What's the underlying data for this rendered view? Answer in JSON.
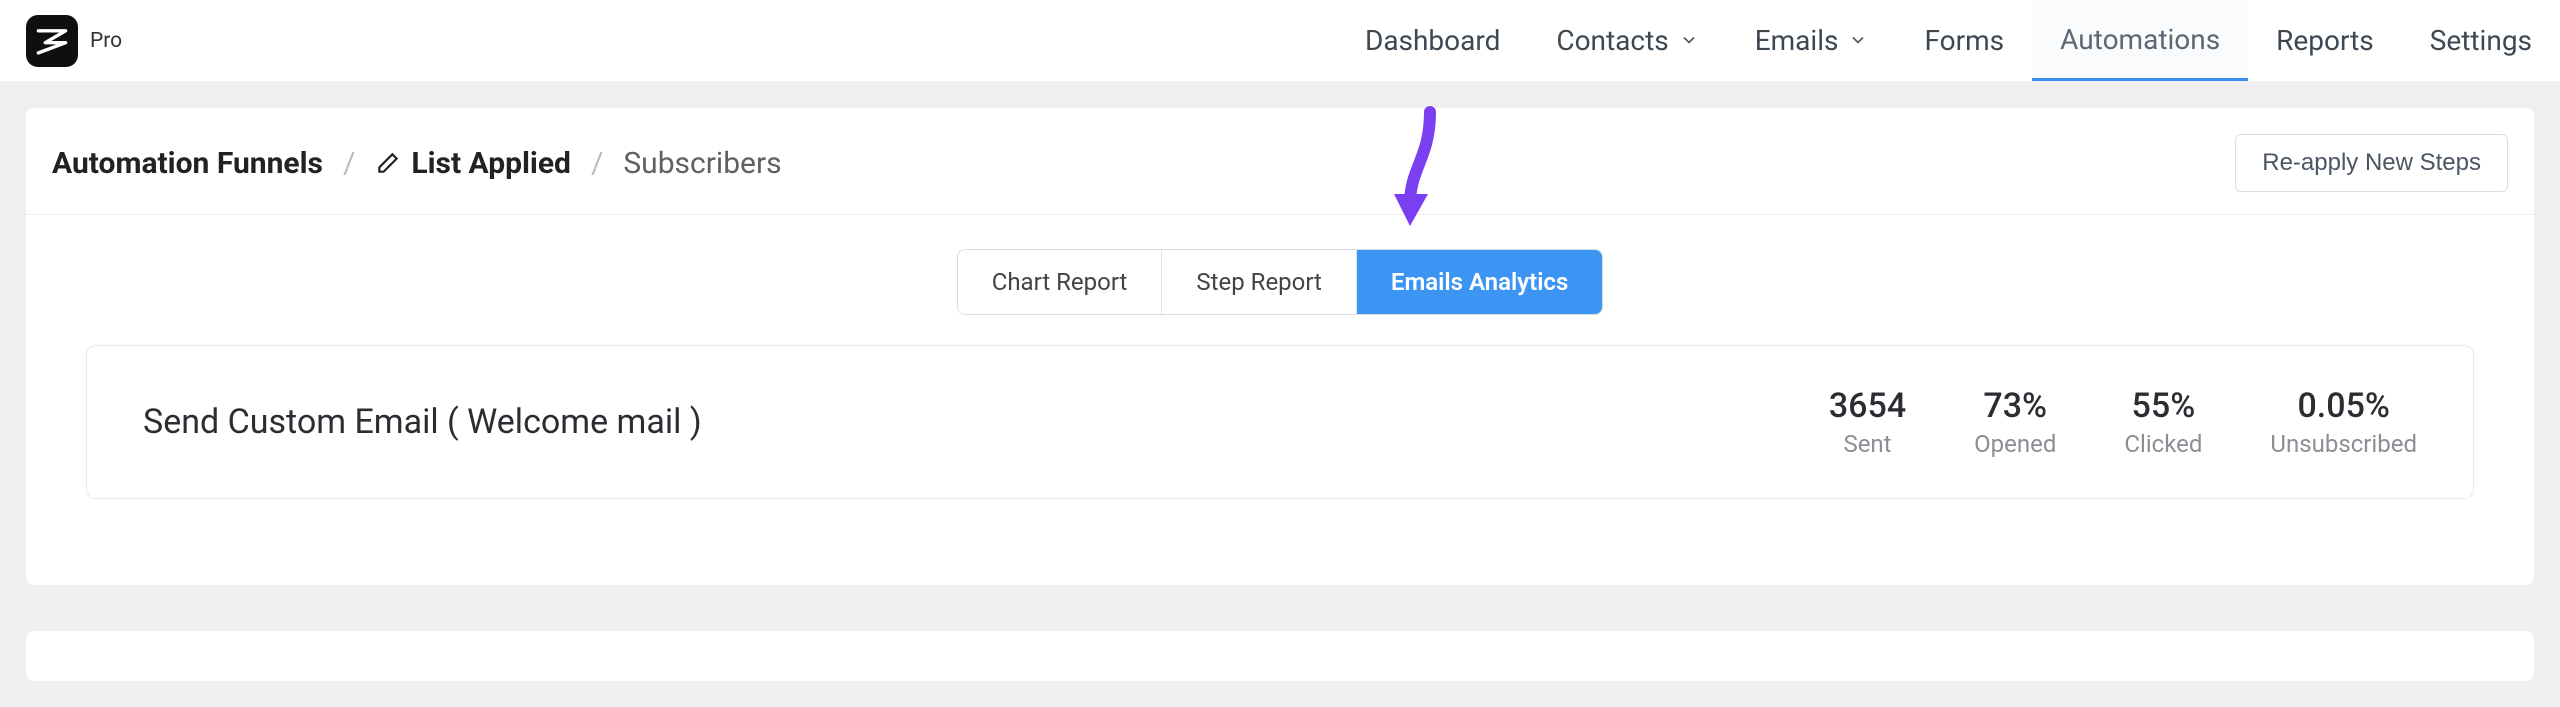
{
  "brand": {
    "label": "Pro"
  },
  "nav": {
    "dashboard": "Dashboard",
    "contacts": "Contacts",
    "emails": "Emails",
    "forms": "Forms",
    "automations": "Automations",
    "reports": "Reports",
    "settings": "Settings"
  },
  "breadcrumb": {
    "root": "Automation Funnels",
    "current": "List Applied",
    "tab": "Subscribers"
  },
  "actions": {
    "reapply": "Re-apply New Steps"
  },
  "tabs": {
    "chart": "Chart Report",
    "step": "Step Report",
    "emails": "Emails Analytics"
  },
  "email_row": {
    "title": "Send Custom Email ( Welcome mail )",
    "sent_value": "3654",
    "sent_label": "Sent",
    "opened_value": "73%",
    "opened_label": "Opened",
    "clicked_value": "55%",
    "clicked_label": "Clicked",
    "unsub_value": "0.05%",
    "unsub_label": "Unsubscribed"
  }
}
